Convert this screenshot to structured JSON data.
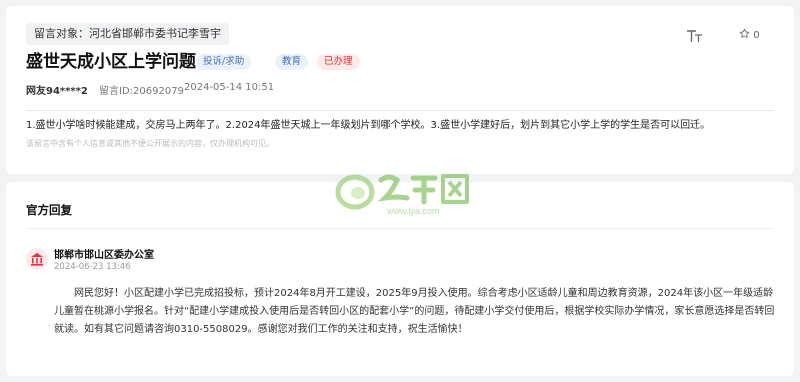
{
  "message": {
    "target_label": "留言对象：河北省邯郸市委书记李雪宇",
    "title": "盛世天成小区上学问题",
    "tags": {
      "type": "投诉/求助",
      "department": "教育",
      "status": "已办理"
    },
    "user": "网友94****2",
    "message_id": "留言ID:20692079",
    "time": "2024-05-14 10:51",
    "font_size_glyph": "TT",
    "favorite_count": "0",
    "content": "1.盛世小学啥时候能建成，交房马上两年了。2.2024年盛世天城上一年级划片到哪个学校。3.盛世小学建好后，划片到其它小学上学的学生是否可以回迁。",
    "privacy_note": "该留言中含有个人信息或其他不便公开展示的内容，仅办理机构可见。"
  },
  "reply": {
    "section_title": "官方回复",
    "watermark": "www.tjia.com",
    "org": "邯郸市邯山区委办公室",
    "time": "2024-06-23 13:46",
    "text": "网民您好！小区配建小学已完成招投标，预计2024年8月开工建设，2025年9月投入使用。综合考虑小区适龄儿童和周边教育资源，2024年该小区一年级适龄儿童暂在桃源小学报名。针对“配建小学建成投入使用后是否转回小区的配套小学”的问题，待配建小学交付使用后，根据学校实际办学情况，家长意愿选择是否转回就读。如有其它问题请咨询0310-5508029。感谢您对我们工作的关注和支持，祝生活愉快！"
  },
  "colors": {
    "background": "#f2f3f5",
    "tag_blue": "#4a74b0",
    "tag_red": "#e0353f",
    "watermark_green": "#6cc04a"
  }
}
